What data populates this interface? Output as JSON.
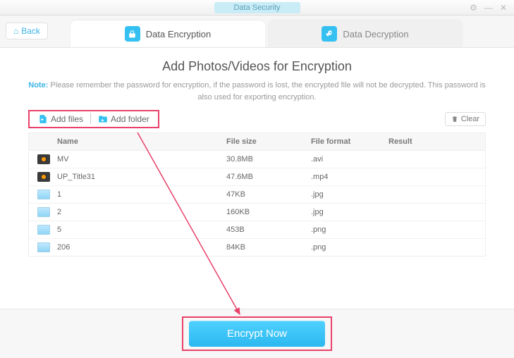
{
  "window": {
    "title": "Data Security"
  },
  "back": {
    "label": "Back"
  },
  "tabs": {
    "encrypt": {
      "label": "Data Encryption"
    },
    "decrypt": {
      "label": "Data Decryption"
    }
  },
  "page": {
    "title": "Add Photos/Videos for Encryption",
    "noteLabel": "Note:",
    "noteText": " Please remember the password for encryption, if the password is lost, the encrypted file will not be decrypted. This password is also used for exporting encryption."
  },
  "toolbar": {
    "addFiles": "Add files",
    "addFolder": "Add folder",
    "clear": "Clear"
  },
  "table": {
    "headers": {
      "name": "Name",
      "size": "File size",
      "format": "File format",
      "result": "Result"
    },
    "rows": [
      {
        "iconType": "vid",
        "name": "MV",
        "size": "30.8MB",
        "format": ".avi",
        "result": ""
      },
      {
        "iconType": "vid",
        "name": "UP_Title31",
        "size": "47.6MB",
        "format": ".mp4",
        "result": ""
      },
      {
        "iconType": "img",
        "name": "1",
        "size": "47KB",
        "format": ".jpg",
        "result": ""
      },
      {
        "iconType": "img",
        "name": "2",
        "size": "160KB",
        "format": ".jpg",
        "result": ""
      },
      {
        "iconType": "img",
        "name": "5",
        "size": "453B",
        "format": ".png",
        "result": ""
      },
      {
        "iconType": "img",
        "name": "206",
        "size": "84KB",
        "format": ".png",
        "result": ""
      }
    ]
  },
  "action": {
    "encryptNow": "Encrypt Now"
  },
  "colors": {
    "accent": "#34c0f0",
    "highlight": "#e9416a"
  }
}
